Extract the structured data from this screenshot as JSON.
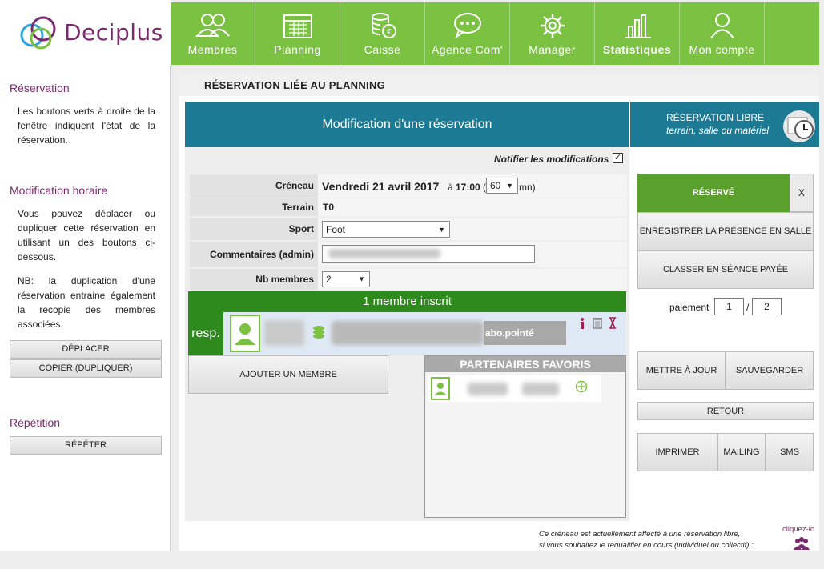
{
  "brand": {
    "name": "Deciplus"
  },
  "nav": [
    {
      "label": "Membres",
      "icon": "members-icon"
    },
    {
      "label": "Planning",
      "icon": "calendar-icon"
    },
    {
      "label": "Caisse",
      "icon": "cash-icon"
    },
    {
      "label": "Agence Com'",
      "icon": "chat-icon"
    },
    {
      "label": "Manager",
      "icon": "gear-icon"
    },
    {
      "label": "Statistiques",
      "icon": "bar-chart-icon"
    },
    {
      "label": "Mon compte",
      "icon": "user-icon"
    }
  ],
  "sidebar": {
    "reservation_title": "Réservation",
    "reservation_text": "Les boutons verts à droite de la fenêtre indiquent l'état de la réservation.",
    "modif_title": "Modification horaire",
    "modif_text": "Vous pouvez déplacer ou dupliquer cette réservation en utilisant un des boutons ci-dessous.",
    "modif_nb": "NB: la duplication d'une réservation entraine également la recopie des membres associées.",
    "btn_move": "DÉPLACER",
    "btn_copy": "COPIER (DUPLIQUER)",
    "repeat_title": "Répétition",
    "btn_repeat": "RÉPÉTER"
  },
  "main": {
    "title": "RÉSERVATION LIÉE AU PLANNING",
    "modif_heading": "Modification d'une réservation",
    "libre_line1": "RÉSERVATION LIBRE",
    "libre_line2": "terrain, salle ou matériel",
    "notify_label": "Notifier les modifications",
    "notify_checked": "✓",
    "creneau_label": "Créneau",
    "creneau_date": "Vendredi 21 avril 2017",
    "creneau_a": "à",
    "creneau_time": "17:00",
    "creneau_paren_open": "(",
    "duration_value": "60",
    "duration_unit": "mn)",
    "terrain_label": "Terrain",
    "terrain_value": "T0",
    "sport_label": "Sport",
    "sport_value": "Foot",
    "comments_label": "Commentaires (admin)",
    "nb_label": "Nb membres",
    "nb_value": "2",
    "inscrit": "1 membre inscrit",
    "resp": "resp.",
    "abo": "abo.pointé",
    "add_member": "AJOUTER UN MEMBRE",
    "partners_title": "PARTENAIRES FAVORIS"
  },
  "actions": {
    "reserve": "RÉSERVÉ",
    "close": "X",
    "presence": "ENREGISTRER LA PRÉSENCE EN SALLE",
    "paid": "CLASSER EN SÉANCE PAYÉE",
    "paiement_label": "paiement",
    "paiement_current": "1",
    "paiement_sep": "/",
    "paiement_total": "2",
    "update": "METTRE À JOUR",
    "save": "SAUVEGARDER",
    "back": "RETOUR",
    "print": "IMPRIMER",
    "mailing": "MAILING",
    "sms": "SMS"
  },
  "footer": {
    "note_line1": "Ce créneau est actuellement affecté à une réservation libre,",
    "note_line2": "si vous souhaitez le requalifier en cours (individuel ou collectif) :",
    "cliquez": "cliquez-ic"
  },
  "colors": {
    "green": "#7cc242",
    "dark_green": "#2f8a1e",
    "teal": "#1c7a94",
    "brand_purple": "#7a2a6e"
  }
}
